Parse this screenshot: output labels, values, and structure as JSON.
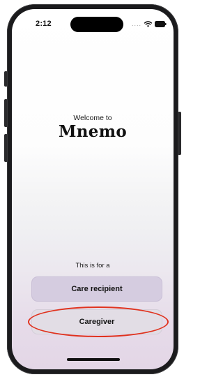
{
  "status_bar": {
    "time": "2:12",
    "signal_dots": "....",
    "wifi_icon": "wifi-icon",
    "battery_icon": "battery-icon"
  },
  "welcome": {
    "greeting": "Welcome to",
    "app_name": "Mnemo"
  },
  "role_selection": {
    "prompt": "This is for a",
    "options": [
      {
        "label": "Care recipient"
      },
      {
        "label": "Caregiver"
      }
    ]
  },
  "colors": {
    "annotation_ellipse": "#e0321e",
    "care_recipient_button": "#d5cce0",
    "caregiver_button": "#e2dde5",
    "phone_frame": "#1b1b1d"
  }
}
